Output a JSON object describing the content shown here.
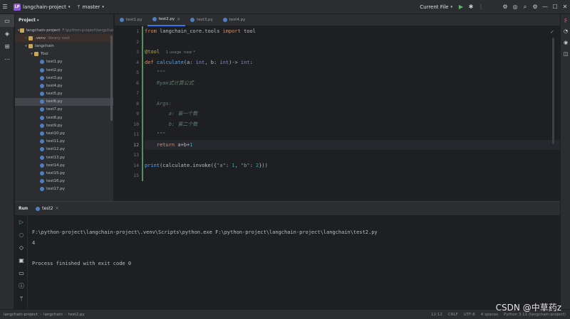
{
  "titlebar": {
    "project_badge": "LP",
    "project_name": "langchain-project",
    "branch": "master",
    "run_config": "Current File"
  },
  "project_panel": {
    "title": "Project",
    "tree": [
      {
        "label": "langchain-project",
        "hint": "F:\\python-project\\langchain-project",
        "type": "folder",
        "depth": 0,
        "arrow": "▾"
      },
      {
        "label": ".venv",
        "hint": "library root",
        "type": "folder",
        "depth": 1,
        "arrow": "›",
        "highlight": true
      },
      {
        "label": "langchain",
        "hint": "",
        "type": "folder",
        "depth": 1,
        "arrow": "▾"
      },
      {
        "label": "Tool",
        "hint": "",
        "type": "folder",
        "depth": 2,
        "arrow": "▾"
      },
      {
        "label": "test1.py",
        "type": "py",
        "depth": 3
      },
      {
        "label": "test2.py",
        "type": "py",
        "depth": 3
      },
      {
        "label": "test3.py",
        "type": "py",
        "depth": 3
      },
      {
        "label": "test4.py",
        "type": "py",
        "depth": 3
      },
      {
        "label": "test5.py",
        "type": "py",
        "depth": 3
      },
      {
        "label": "test6.py",
        "type": "py",
        "depth": 3,
        "selected": true
      },
      {
        "label": "test7.py",
        "type": "py",
        "depth": 3
      },
      {
        "label": "test8.py",
        "type": "py",
        "depth": 3
      },
      {
        "label": "test9.py",
        "type": "py",
        "depth": 3
      },
      {
        "label": "test10.py",
        "type": "py",
        "depth": 3
      },
      {
        "label": "test11.py",
        "type": "py",
        "depth": 3
      },
      {
        "label": "test12.py",
        "type": "py",
        "depth": 3
      },
      {
        "label": "test13.py",
        "type": "py",
        "depth": 3
      },
      {
        "label": "test14.py",
        "type": "py",
        "depth": 3
      },
      {
        "label": "test15.py",
        "type": "py",
        "depth": 3
      },
      {
        "label": "test16.py",
        "type": "py",
        "depth": 3
      },
      {
        "label": "test17.py",
        "type": "py",
        "depth": 3
      }
    ]
  },
  "editor_tabs": [
    {
      "label": "test1.py",
      "active": false
    },
    {
      "label": "test2.py",
      "active": true
    },
    {
      "label": "test3.py",
      "active": false
    },
    {
      "label": "test4.py",
      "active": false
    }
  ],
  "editor": {
    "line_numbers": [
      "1",
      "2",
      "3",
      "4",
      "5",
      "6",
      "7",
      "8",
      "9",
      "10",
      "11",
      "12",
      "13",
      "14",
      "15"
    ],
    "current_line": "12",
    "usage_hint": "1 usage  new *"
  },
  "run_panel": {
    "title": "Run",
    "tab_label": "test2",
    "console": [
      "F:\\python-project\\langchain-project\\.venv\\Scripts\\python.exe F:\\python-project\\langchain-project\\langchain\\test2.py",
      "4",
      "",
      "Process finished with exit code 0"
    ]
  },
  "statusbar": {
    "crumbs": [
      "langchain-project",
      "langchain",
      "test2.py"
    ],
    "right": [
      "12:12",
      "CRLF",
      "UTF-8",
      "4 spaces",
      "Python 3.11 (langchain-project)"
    ]
  },
  "watermark": "CSDN @中草药z"
}
